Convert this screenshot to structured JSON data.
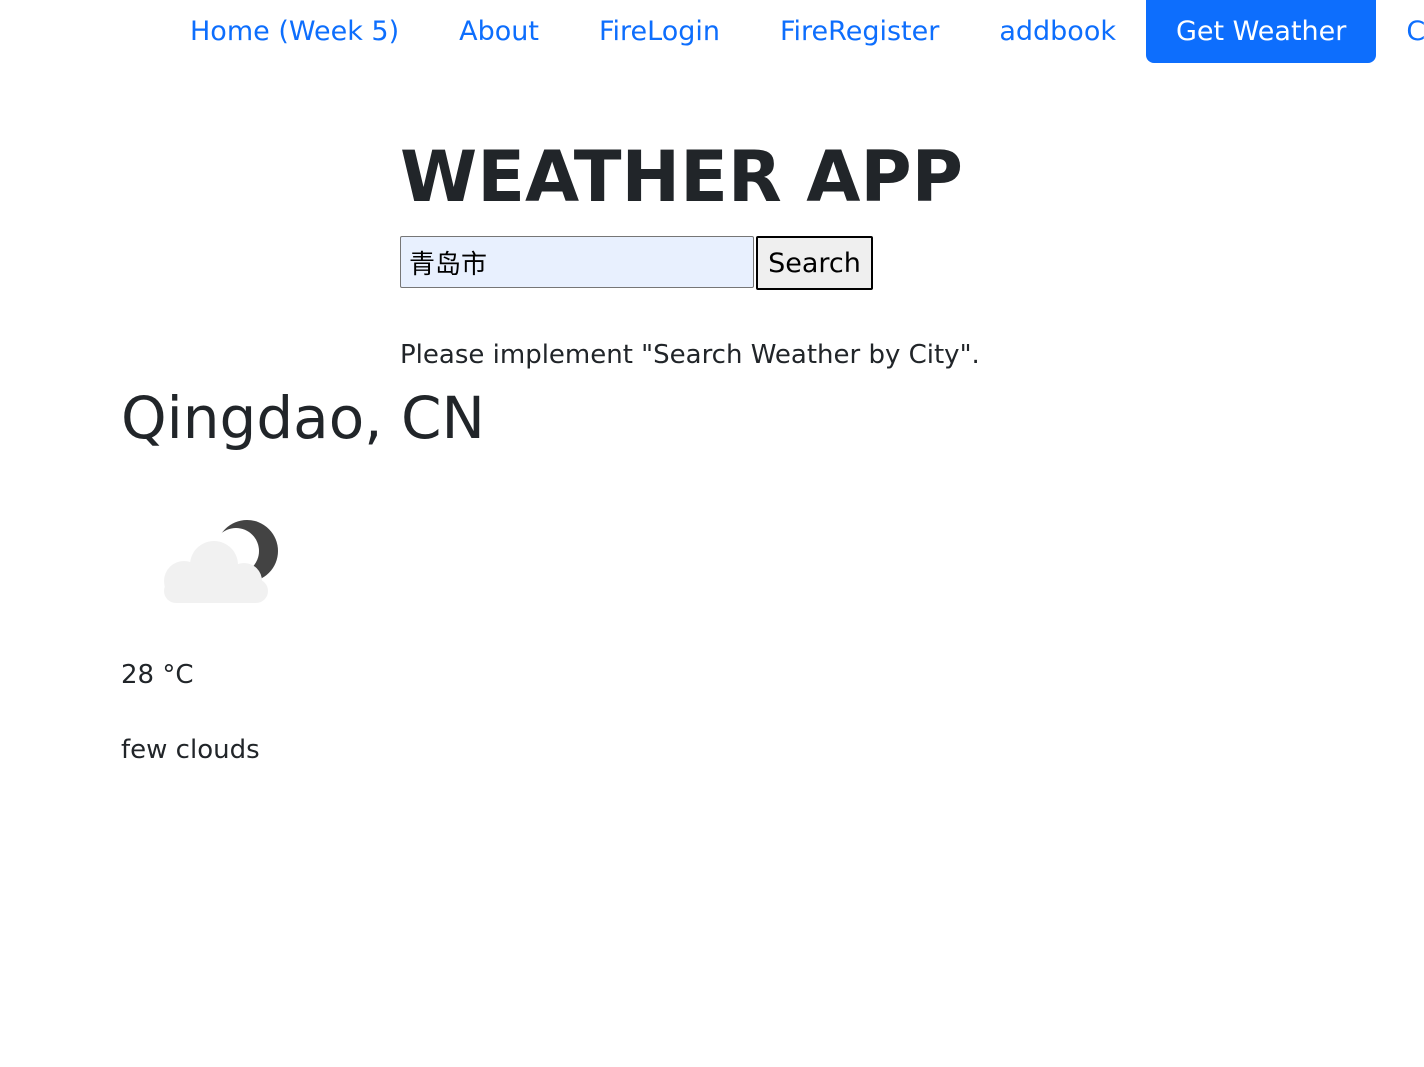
{
  "nav": {
    "items": [
      {
        "label": "Home (Week 5)"
      },
      {
        "label": "About"
      },
      {
        "label": "FireLogin"
      },
      {
        "label": "FireRegister"
      },
      {
        "label": "addbook"
      },
      {
        "label": "Get Weather",
        "active": true
      },
      {
        "label": "Co"
      }
    ],
    "accent_color": "#0d6efd"
  },
  "app": {
    "title": "WEATHER APP"
  },
  "search": {
    "value": "青岛市",
    "button_label": "Search"
  },
  "notice": "Please implement \"Search Weather by City\".",
  "weather": {
    "city": "Qingdao, CN",
    "icon": "few-clouds-night-icon",
    "temperature": "28 °C",
    "description": "few clouds"
  }
}
